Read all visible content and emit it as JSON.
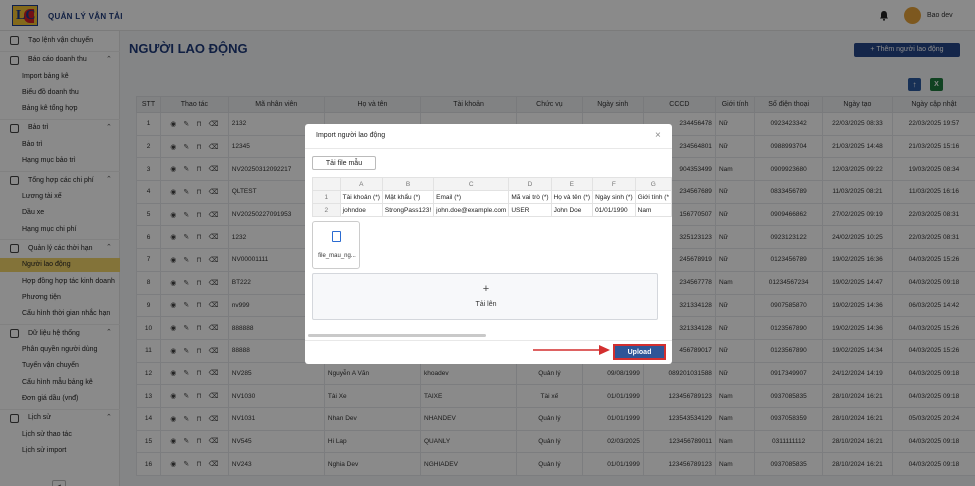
{
  "header": {
    "app_title": "QUẢN LÝ VẬN TẢI",
    "logo_text": "LC",
    "user_name": "Bao dev"
  },
  "sidebar": {
    "items": [
      {
        "label": "Tạo lệnh vận chuyển",
        "type": "top",
        "icon": "truck-icon"
      },
      {
        "label": "Báo cáo doanh thu",
        "type": "group",
        "icon": "chart-icon"
      },
      {
        "label": "Import bảng kê",
        "type": "sub"
      },
      {
        "label": "Biểu đồ doanh thu",
        "type": "sub"
      },
      {
        "label": "Bảng kê tổng hợp",
        "type": "sub"
      },
      {
        "label": "Bảo trì",
        "type": "group",
        "icon": "wrench-icon"
      },
      {
        "label": "Bảo trì",
        "type": "sub"
      },
      {
        "label": "Hạng mục bảo trì",
        "type": "sub"
      },
      {
        "label": "Tổng hợp các chi phí",
        "type": "group",
        "icon": "money-icon"
      },
      {
        "label": "Lương tài xế",
        "type": "sub"
      },
      {
        "label": "Dầu xe",
        "type": "sub"
      },
      {
        "label": "Hạng mục chi phí",
        "type": "sub"
      },
      {
        "label": "Quản lý các thời hạn",
        "type": "group",
        "icon": "clock-icon"
      },
      {
        "label": "Người lao động",
        "type": "sub",
        "active": true
      },
      {
        "label": "Hợp đồng hợp tác kinh doanh",
        "type": "sub"
      },
      {
        "label": "Phương tiện",
        "type": "sub"
      },
      {
        "label": "Cấu hình thời gian nhắc hạn",
        "type": "sub"
      },
      {
        "label": "Dữ liệu hệ thống",
        "type": "group",
        "icon": "database-icon"
      },
      {
        "label": "Phân quyền người dùng",
        "type": "sub"
      },
      {
        "label": "Tuyến vận chuyển",
        "type": "sub"
      },
      {
        "label": "Cấu hình mẫu bảng kê",
        "type": "sub"
      },
      {
        "label": "Đơn giá dầu (vnđ)",
        "type": "sub"
      },
      {
        "label": "Lịch sử",
        "type": "group",
        "icon": "history-icon"
      },
      {
        "label": "Lịch sử thao tác",
        "type": "sub"
      },
      {
        "label": "Lịch sử import",
        "type": "sub"
      }
    ]
  },
  "page": {
    "title": "NGƯỜI LAO ĐỘNG",
    "add_button": "+ Thêm người lao động",
    "excel_icon_text": "X"
  },
  "table": {
    "columns": [
      "STT",
      "Thao tác",
      "Mã nhân viên",
      "Họ và tên",
      "Tài khoản",
      "Chức vụ",
      "Ngày sinh",
      "CCCD",
      "Giới tính",
      "Số điện thoại",
      "Ngày tạo",
      "Ngày cập nhật"
    ],
    "rows": [
      [
        "1",
        "",
        "2132",
        "",
        "",
        "",
        "",
        "234456478",
        "Nữ",
        "0923423342",
        "22/03/2025 08:33",
        "22/03/2025 19:57"
      ],
      [
        "2",
        "",
        "12345",
        "",
        "",
        "",
        "",
        "234564801",
        "Nữ",
        "0988993704",
        "21/03/2025 14:48",
        "21/03/2025 15:16"
      ],
      [
        "3",
        "",
        "NV20250312092217",
        "",
        "",
        "",
        "",
        "904353499",
        "Nam",
        "0909923680",
        "12/03/2025 09:22",
        "19/03/2025 08:34"
      ],
      [
        "4",
        "",
        "QLTEST",
        "",
        "",
        "",
        "",
        "234567689",
        "Nữ",
        "0833456789",
        "11/03/2025 08:21",
        "11/03/2025 16:16"
      ],
      [
        "5",
        "",
        "NV20250227091953",
        "",
        "",
        "",
        "",
        "156770507",
        "Nữ",
        "0909466862",
        "27/02/2025 09:19",
        "22/03/2025 08:31"
      ],
      [
        "6",
        "",
        "1232",
        "",
        "",
        "",
        "",
        "325123123",
        "Nữ",
        "0923123122",
        "24/02/2025 10:25",
        "22/03/2025 08:31"
      ],
      [
        "7",
        "",
        "NV00001111",
        "",
        "",
        "",
        "",
        "245678919",
        "Nữ",
        "0123456789",
        "19/02/2025 16:36",
        "04/03/2025 15:26"
      ],
      [
        "8",
        "",
        "BT222",
        "",
        "",
        "",
        "",
        "234567778",
        "Nam",
        "01234567234",
        "19/02/2025 14:47",
        "04/03/2025 09:18"
      ],
      [
        "9",
        "",
        "nv999",
        "",
        "",
        "",
        "",
        "321334128",
        "Nữ",
        "0907585870",
        "19/02/2025 14:36",
        "06/03/2025 14:42"
      ],
      [
        "10",
        "",
        "888888",
        "",
        "",
        "",
        "",
        "321334128",
        "Nữ",
        "0123567890",
        "19/02/2025 14:36",
        "04/03/2025 15:26"
      ],
      [
        "11",
        "",
        "88888",
        "",
        "",
        "",
        "",
        "456789017",
        "Nữ",
        "0123567890",
        "19/02/2025 14:34",
        "04/03/2025 15:26"
      ],
      [
        "12",
        "",
        "NV285",
        "Nguyễn A Văn",
        "khoadev",
        "Quản lý",
        "09/08/1999",
        "089201031588",
        "Nữ",
        "0917349907",
        "24/12/2024 14:19",
        "04/03/2025 09:18"
      ],
      [
        "13",
        "",
        "NV1030",
        "Tài Xe",
        "TAIXE",
        "Tài xế",
        "01/01/1999",
        "123456789123",
        "Nam",
        "0937085835",
        "28/10/2024 16:21",
        "04/03/2025 09:18"
      ],
      [
        "14",
        "",
        "NV1031",
        "Nhan Dev",
        "NHANDEV",
        "Quản lý",
        "01/01/1999",
        "123543534129",
        "Nam",
        "0937058359",
        "28/10/2024 16:21",
        "05/03/2025 20:24"
      ],
      [
        "15",
        "",
        "NV545",
        "Hi Lap",
        "QUANLY",
        "Quản lý",
        "02/03/2025",
        "123456789011",
        "Nam",
        "0311111112",
        "28/10/2024 16:21",
        "04/03/2025 09:18"
      ],
      [
        "16",
        "",
        "NV243",
        "Nghia Dev",
        "NGHIADEV",
        "Quản lý",
        "01/01/1999",
        "123456789123",
        "Nam",
        "0937085835",
        "28/10/2024 16:21",
        "04/03/2025 09:18"
      ]
    ]
  },
  "modal": {
    "title": "Import người lao động",
    "close": "×",
    "template_button": "Tải file mẫu",
    "sheet": {
      "col_headers": [
        "",
        "A",
        "B",
        "C",
        "D",
        "E",
        "F",
        "G"
      ],
      "rows": [
        [
          "1",
          "Tài khoản (*)",
          "Mật khẩu (*)",
          "Email (*)",
          "Mã vai trò (*)",
          "Họ và tên (*)",
          "Ngày sinh (*)",
          "Giới tính (*"
        ],
        [
          "2",
          "johndoe",
          "StrongPass123!",
          "john.doe@example.com",
          "USER",
          "John Doe",
          "01/01/1990",
          "Nam"
        ]
      ]
    },
    "file_name": "file_mau_ng...",
    "dropzone_plus": "+",
    "dropzone_label": "Tải lên",
    "upload_button": "Upload"
  },
  "colors": {
    "brand_blue": "#26478a",
    "active_item": "#f3d46a",
    "highlight_red": "#d32f2f"
  }
}
